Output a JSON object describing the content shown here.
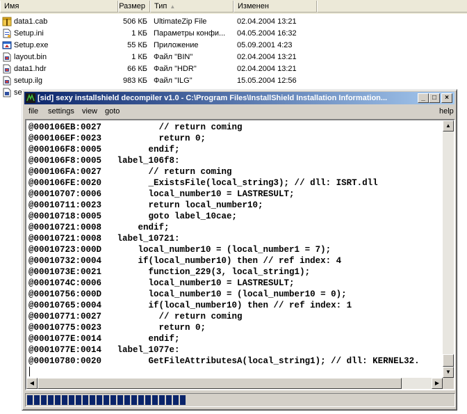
{
  "explorer": {
    "columns": {
      "name": "Имя",
      "size": "Размер",
      "type": "Тип",
      "modified": "Изменен"
    },
    "files": [
      {
        "name": "data1.cab",
        "size": "506 КБ",
        "type": "UltimateZip File",
        "modified": "02.04.2004 13:21",
        "icon": "archive-icon"
      },
      {
        "name": "Setup.ini",
        "size": "1 КБ",
        "type": "Параметры конфи...",
        "modified": "04.05.2004 16:32",
        "icon": "ini-file-icon"
      },
      {
        "name": "Setup.exe",
        "size": "55 КБ",
        "type": "Приложение",
        "modified": "05.09.2001 4:23",
        "icon": "exe-file-icon"
      },
      {
        "name": "layout.bin",
        "size": "1 КБ",
        "type": "Файл \"BIN\"",
        "modified": "02.04.2004 13:21",
        "icon": "bin-file-icon"
      },
      {
        "name": "data1.hdr",
        "size": "66 КБ",
        "type": "Файл \"HDR\"",
        "modified": "02.04.2004 13:21",
        "icon": "hdr-file-icon"
      },
      {
        "name": "setup.ilg",
        "size": "983 КБ",
        "type": "Файл \"ILG\"",
        "modified": "15.05.2004 12:56",
        "icon": "ilg-file-icon"
      },
      {
        "name": "se",
        "size": "",
        "type": "",
        "modified": "",
        "icon": "file-icon"
      }
    ]
  },
  "window": {
    "title": "[sid] sexy installshield decompiler v1.0 - C:\\Program Files\\InstallShield Installation Information...",
    "controls": {
      "minimize": "_",
      "maximize": "□",
      "close": "×"
    },
    "menu": {
      "file": "file",
      "settings": "settings",
      "view": "view",
      "goto": "goto",
      "help": "help"
    },
    "code_lines": [
      "@000106EB:0027           // return coming",
      "@000106EF:0023           return 0;",
      "@000106F8:0005         endif;",
      "@000106F8:0005   label_106f8:",
      "@000106FA:0027         // return coming",
      "@000106FE:0020         _ExistsFile(local_string3); // dll: ISRT.dll",
      "@00010707:0006         local_number10 = LASTRESULT;",
      "@00010711:0023         return local_number10;",
      "@00010718:0005         goto label_10cae;",
      "@00010721:0008       endif;",
      "@00010721:0008   label_10721:",
      "@00010723:000D       local_number10 = (local_number1 = 7);",
      "@00010732:0004       if(local_number10) then // ref index: 4",
      "@0001073E:0021         function_229(3, local_string1);",
      "@0001074C:0006         local_number10 = LASTRESULT;",
      "@00010756:000D         local_number10 = (local_number10 = 0);",
      "@00010765:0004         if(local_number10) then // ref index: 1",
      "@00010771:0027           // return coming",
      "@00010775:0023           return 0;",
      "@0001077E:0014         endif;",
      "@0001077E:0014   label_1077e:",
      "@00010780:0020         GetFileAttributesA(local_string1); // dll: KERNEL32."
    ],
    "progress": 0.39
  }
}
